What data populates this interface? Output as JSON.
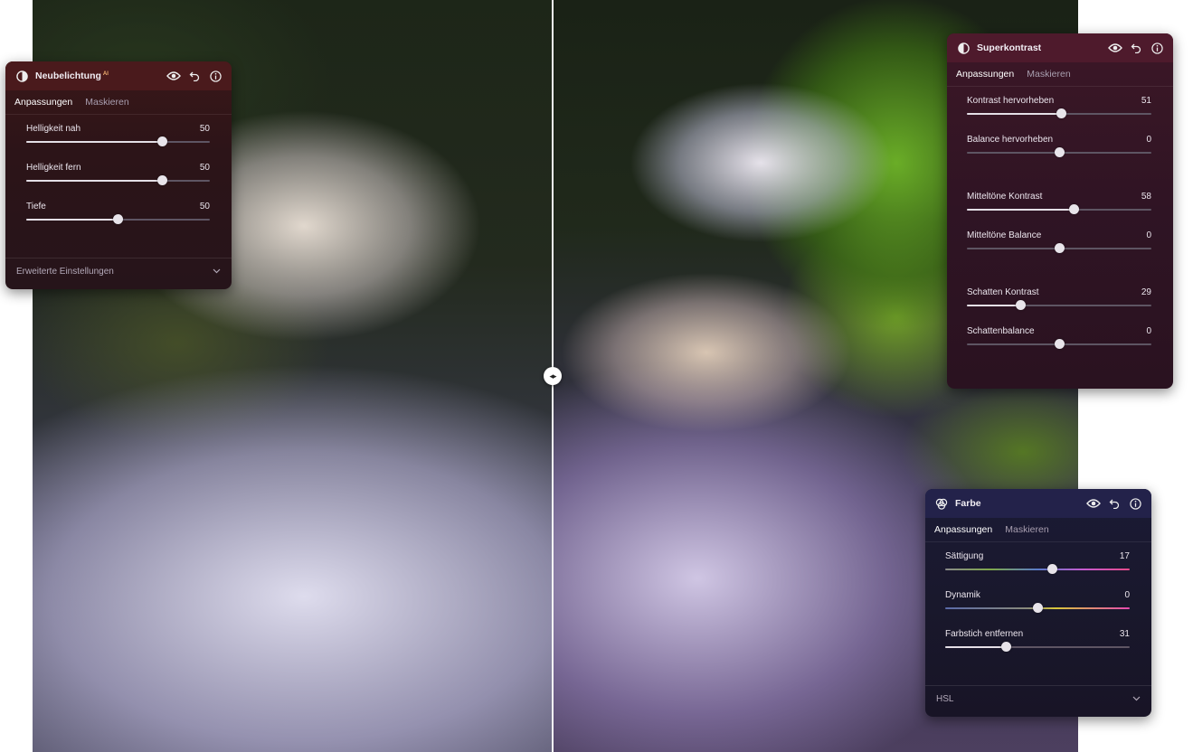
{
  "neubelichtung": {
    "title": "Neubelichtung",
    "ai_badge": "AI",
    "tabs": [
      "Anpassungen",
      "Maskieren"
    ],
    "sliders": [
      {
        "label": "Helligkeit nah",
        "value": "50",
        "position": 0.74
      },
      {
        "label": "Helligkeit fern",
        "value": "50",
        "position": 0.74
      },
      {
        "label": "Tiefe",
        "value": "50",
        "position": 0.5
      }
    ],
    "footer": "Erweiterte Einstellungen"
  },
  "superkontrast": {
    "title": "Superkontrast",
    "tabs": [
      "Anpassungen",
      "Maskieren"
    ],
    "sliders": [
      {
        "label": "Kontrast hervorheben",
        "value": "51",
        "position": 0.51
      },
      {
        "label": "Balance hervorheben",
        "value": "0",
        "position": 0.5
      },
      {
        "label": "Mitteltöne Kontrast",
        "value": "58",
        "position": 0.58
      },
      {
        "label": "Mitteltöne Balance",
        "value": "0",
        "position": 0.5
      },
      {
        "label": "Schatten Kontrast",
        "value": "29",
        "position": 0.29
      },
      {
        "label": "Schattenbalance",
        "value": "0",
        "position": 0.5
      }
    ]
  },
  "farbe": {
    "title": "Farbe",
    "tabs": [
      "Anpassungen",
      "Maskieren"
    ],
    "sliders": [
      {
        "label": "Sättigung",
        "value": "17",
        "position": 0.58
      },
      {
        "label": "Dynamik",
        "value": "0",
        "position": 0.5
      },
      {
        "label": "Farbstich entfernen",
        "value": "31",
        "position": 0.33
      }
    ],
    "footer": "HSL"
  },
  "colors": {
    "neubelichtung_header": "#4a1a1c",
    "superkontrast_header": "#4e1a2c",
    "farbe_header": "#23224a",
    "slider_fill": "#e4dfe6"
  }
}
